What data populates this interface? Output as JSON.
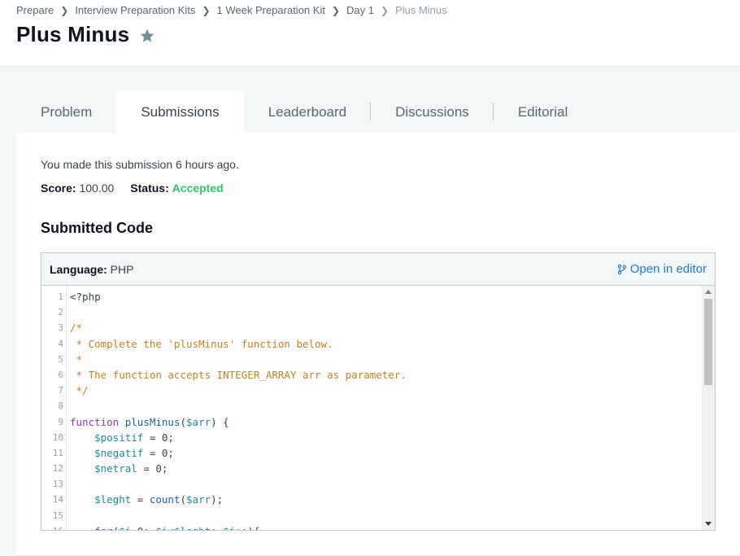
{
  "breadcrumb": [
    "Prepare",
    "Interview Preparation Kits",
    "1 Week Preparation Kit",
    "Day 1",
    "Plus Minus"
  ],
  "page_title": "Plus Minus",
  "tabs": [
    {
      "label": "Problem"
    },
    {
      "label": "Submissions"
    },
    {
      "label": "Leaderboard"
    },
    {
      "label": "Discussions"
    },
    {
      "label": "Editorial"
    }
  ],
  "submission": {
    "info": "You made this submission 6 hours ago.",
    "score_label": "Score:",
    "score_value": "100.00",
    "status_label": "Status:",
    "status_value": "Accepted"
  },
  "submitted_code_title": "Submitted Code",
  "code": {
    "language_label": "Language:",
    "language_value": "PHP",
    "open_in_editor": "Open in editor"
  },
  "colors": {
    "accepted": "#2ec866",
    "link": "#1f7bd3"
  }
}
